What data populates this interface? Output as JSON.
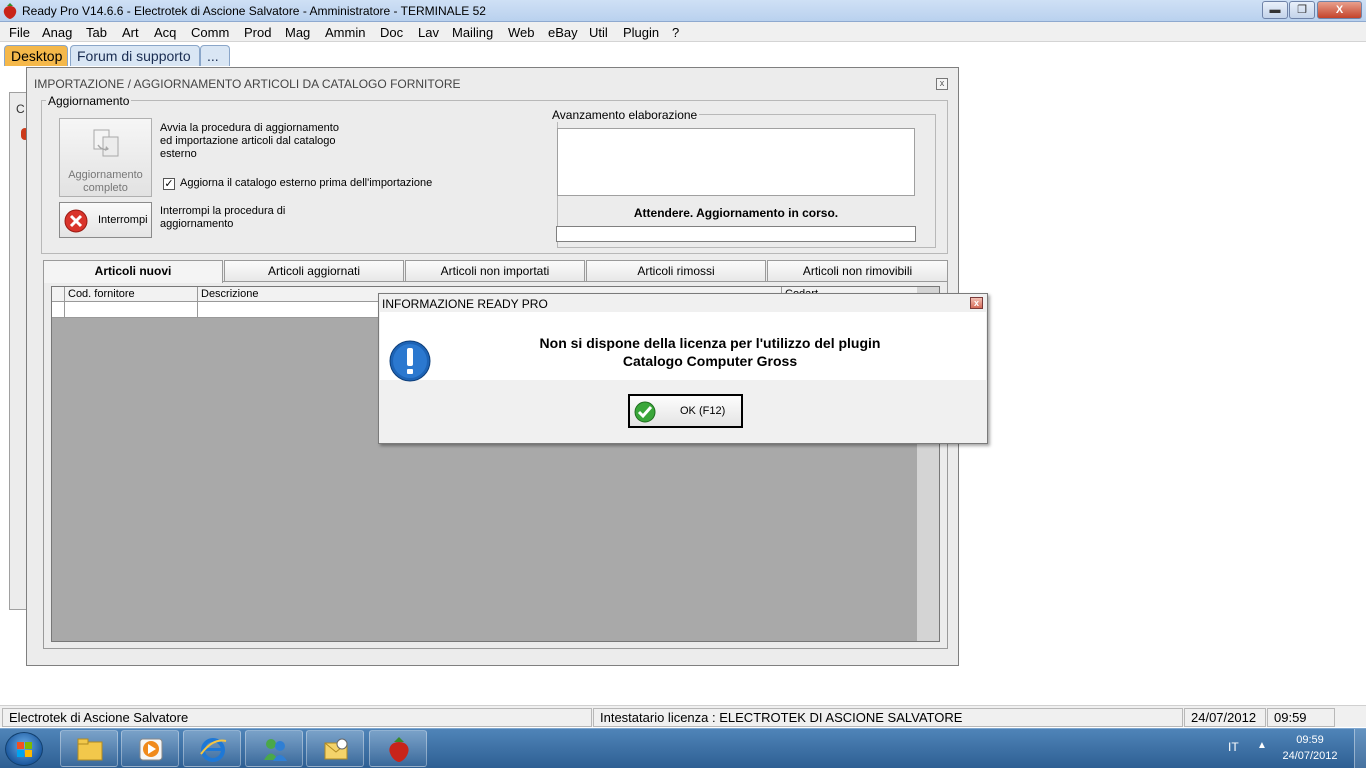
{
  "window": {
    "title": "Ready Pro V14.6.6 - Electrotek di Ascione Salvatore - Amministratore - TERMINALE 52",
    "minimize": "▬",
    "maximize": "❐",
    "close": "X"
  },
  "menu": [
    "File",
    "Anag",
    "Tab",
    "Art",
    "Acq",
    "Comm",
    "Prod",
    "Mag",
    "Ammin",
    "Doc",
    "Lav",
    "Mailing",
    "Web",
    "eBay",
    "Util",
    "Plugin",
    "?"
  ],
  "tabs": {
    "desktop": "Desktop",
    "forum": "Forum di supporto",
    "more": "..."
  },
  "background_window": {
    "label": "C"
  },
  "dialog": {
    "title": "IMPORTAZIONE / AGGIORNAMENTO ARTICOLI DA CATALOGO FORNITORE",
    "close": "x",
    "aggiornamento": {
      "group_label": "Aggiornamento",
      "button_line1": "Aggiornamento",
      "button_line2": "completo",
      "desc_lines": [
        "Avvia la procedura di aggiornamento",
        "ed importazione articoli dal catalogo",
        "esterno"
      ],
      "checkbox_checked": true,
      "checkbox_mark": "✓",
      "checkbox_label": "Aggiorna il catalogo esterno prima dell'importazione",
      "interrompi_label": "Interrompi",
      "interrompi_desc": [
        "Interrompi la procedura di",
        "aggiornamento"
      ]
    },
    "avanzamento": {
      "group_label": "Avanzamento elaborazione",
      "status": "Attendere. Aggiornamento in corso.",
      "progress": 0
    },
    "article_tabs": [
      "Articoli nuovi",
      "Articoli aggiornati",
      "Articoli non importati",
      "Articoli rimossi",
      "Articoli non rimovibili"
    ],
    "active_tab": 0,
    "grid": {
      "columns": [
        "Cod. fornitore",
        "Descrizione",
        "",
        "Codart"
      ]
    }
  },
  "info_dialog": {
    "title": "INFORMAZIONE READY PRO",
    "close": "x",
    "message_line1": "Non si dispone della licenza per l'utilizzo del plugin",
    "message_line2": "Catalogo Computer Gross",
    "ok_label": "OK (F12)"
  },
  "statusbar": {
    "company": "Electrotek di Ascione Salvatore",
    "license": "Intestatario licenza : ELECTROTEK DI ASCIONE SALVATORE",
    "date": "24/07/2012",
    "time": "09:59"
  },
  "taskbar": {
    "apps": [
      "explorer-icon",
      "media-player-icon",
      "internet-explorer-icon",
      "messenger-icon",
      "outlook-icon",
      "ready-pro-icon"
    ],
    "lang": "IT",
    "arrow": "▲",
    "time": "09:59",
    "date": "24/07/2012"
  },
  "colors": {
    "desktop_tab": "#f5b84a",
    "taskbar": "#2e5f93",
    "grid_bg": "#a9a9a9"
  }
}
